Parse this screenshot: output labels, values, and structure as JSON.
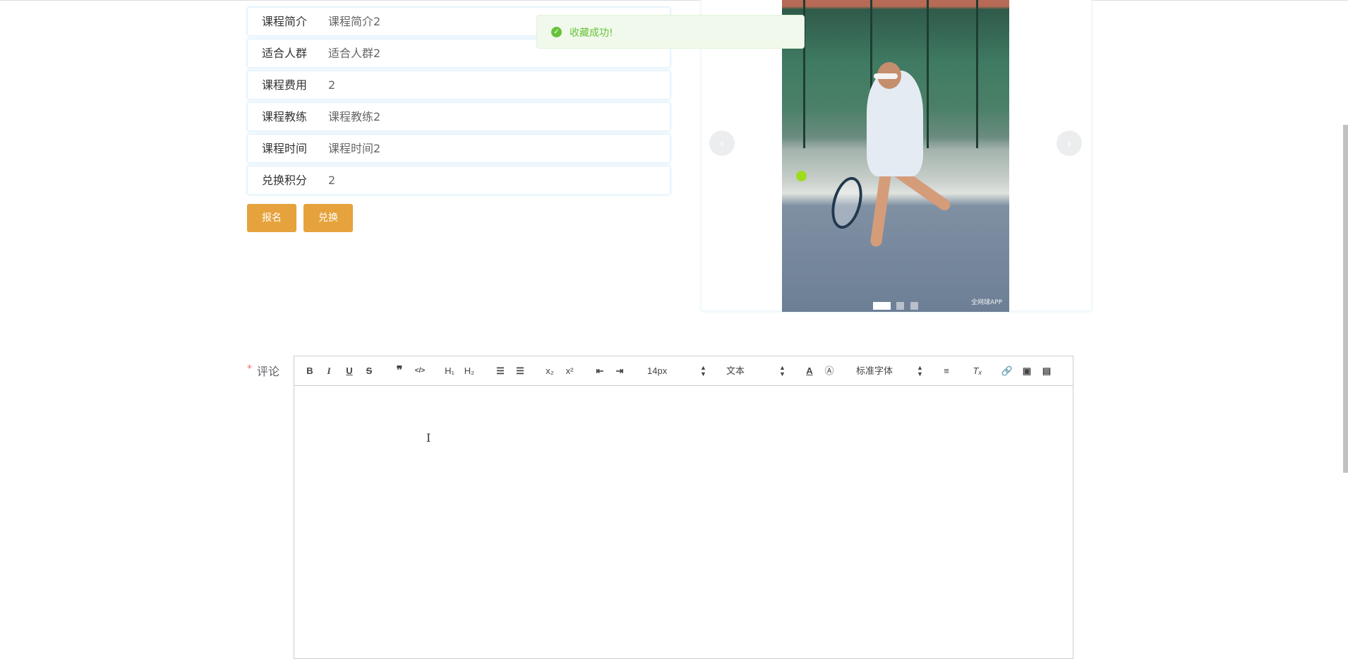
{
  "details": [
    {
      "label": "课程简介",
      "value": "课程简介2"
    },
    {
      "label": "适合人群",
      "value": "适合人群2"
    },
    {
      "label": "课程费用",
      "value": "2"
    },
    {
      "label": "课程教练",
      "value": "课程教练2"
    },
    {
      "label": "课程时间",
      "value": "课程时间2"
    },
    {
      "label": "兑换积分",
      "value": "2"
    }
  ],
  "buttons": {
    "signup": "报名",
    "exchange": "兑换"
  },
  "toast": {
    "message": "收藏成功!",
    "icon": "check-circle-icon",
    "color": "#67c23a"
  },
  "carousel": {
    "watermark": "全网球APP",
    "slide_count": 3,
    "active_index": 0
  },
  "comment": {
    "required_mark": "*",
    "label": "评论"
  },
  "toolbar": {
    "size": "14px",
    "header": "文本",
    "font": "标准字体"
  },
  "accent": "#e6a23c"
}
